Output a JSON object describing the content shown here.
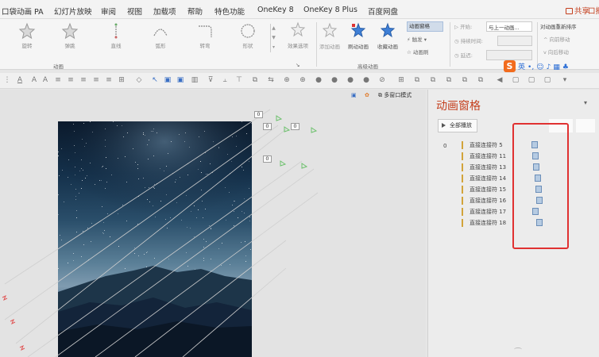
{
  "menu": {
    "items": [
      "口袋动画 PA",
      "幻灯片放映",
      "审阅",
      "视图",
      "加载项",
      "帮助",
      "特色功能",
      "OneKey 8",
      "OneKey 8 Plus",
      "百度网盘"
    ],
    "share_label": "共享",
    "comment_label": "口批"
  },
  "ribbon": {
    "animation_buttons": [
      {
        "label": "旋转",
        "icon": "spin-star-icon"
      },
      {
        "label": "弹跳",
        "icon": "bounce-star-icon"
      },
      {
        "label": "直线",
        "icon": "line-path-icon"
      },
      {
        "label": "弧形",
        "icon": "arc-path-icon"
      },
      {
        "label": "转弯",
        "icon": "turn-path-icon"
      },
      {
        "label": "形状",
        "icon": "shape-path-icon"
      }
    ],
    "effect_options_label": "效果选项",
    "animation_group_label": "动画",
    "add_animation_label": "添加动画",
    "brush_animation_label": "刷动动画",
    "favorite_animation_label": "收藏动画",
    "anim_pane_label": "动画窗格",
    "trigger_label": "触发",
    "anim_brush_label": "动画刷",
    "advanced_group_label": "高级动画",
    "timing": {
      "start_label": "开始:",
      "start_value": "与上一动画...",
      "duration_label": "持续时间:",
      "delay_label": "延迟:"
    },
    "reorder": {
      "title": "对动画重新排序",
      "forward": "向前移动",
      "backward": "向后移动"
    }
  },
  "ime": {
    "logo": "S",
    "mode": "英"
  },
  "view": {
    "multiwindow_label": "多窗口模式"
  },
  "slide": {
    "tags": [
      "0",
      "0",
      "0",
      "0"
    ]
  },
  "anim_pane": {
    "title": "动画窗格",
    "play_all_label": "全部播放",
    "sequence_number": "0",
    "items": [
      {
        "label": "直接连接符 5",
        "bar_offset": 0.0
      },
      {
        "label": "直接连接符 11",
        "bar_offset": 0.1
      },
      {
        "label": "直接连接符 13",
        "bar_offset": 0.2
      },
      {
        "label": "直接连接符 14",
        "bar_offset": 0.3
      },
      {
        "label": "直接连接符 15",
        "bar_offset": 0.4
      },
      {
        "label": "直接连接符 16",
        "bar_offset": 0.5
      },
      {
        "label": "直接连接符 17",
        "bar_offset": 0.1
      },
      {
        "label": "直接连接符 18",
        "bar_offset": 0.5
      }
    ]
  },
  "colors": {
    "accent": "#c43e1c",
    "highlight": "#e03131",
    "timing_bar": "#b6cbe2"
  }
}
